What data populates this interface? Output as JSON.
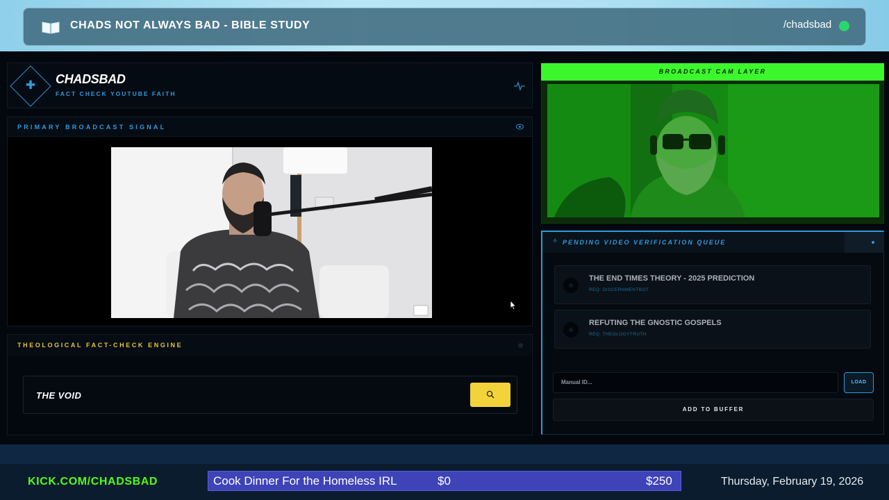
{
  "top_banner": {
    "title": "CHADS NOT ALWAYS BAD - BIBLE STUDY",
    "handle": "/chadsbad",
    "icon": "open-book-icon",
    "live_color": "#2bd66e"
  },
  "brand": {
    "name": "CHADSBAD",
    "tagline": "FACT CHECK YOUTUBE FAITH",
    "logo_icon": "plus-diamond-icon",
    "status_icon": "pulse-icon"
  },
  "broadcast": {
    "label": "PRIMARY BROADCAST SIGNAL",
    "status_icon": "eye-icon"
  },
  "fact_check": {
    "label": "THEOLOGICAL FACT-CHECK ENGINE",
    "input_value": "THE VOID",
    "search_icon": "search-icon",
    "accent": "#f2d43a"
  },
  "cam": {
    "label": "BROADCAST CAM LAYER",
    "accent": "#3cf72c"
  },
  "queue": {
    "label": "PENDING VIDEO VERIFICATION QUEUE",
    "items": [
      {
        "title": "THE END TIMES THEORY - 2025 PREDICTION",
        "requester": "REQ: DISCERNMENTBOT"
      },
      {
        "title": "REFUTING THE GNOSTIC GOSPELS",
        "requester": "REQ: THEOLOGYTRUTH"
      }
    ],
    "input_placeholder": "Manual ID...",
    "load_label": "LOAD",
    "add_label": "ADD TO BUFFER",
    "accent": "#2a9ce0"
  },
  "ticker": {
    "url": "KICK.COM/CHADSBAD",
    "goal_title": "Cook Dinner For the Homeless IRL",
    "goal_current": "$0",
    "goal_target": "$250",
    "goal_progress": 0,
    "date": "Thursday, February 19, 2026"
  }
}
